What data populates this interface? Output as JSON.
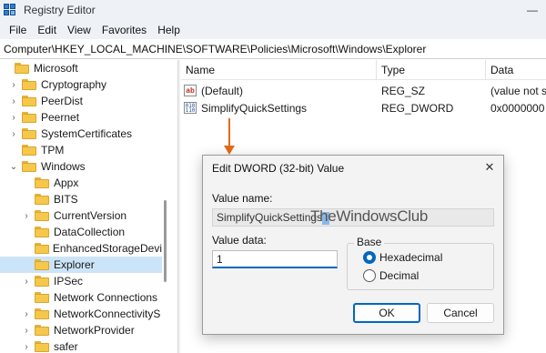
{
  "window": {
    "title": "Registry Editor",
    "minimize": "—",
    "close": "✕"
  },
  "menu": [
    "File",
    "Edit",
    "View",
    "Favorites",
    "Help"
  ],
  "address": "Computer\\HKEY_LOCAL_MACHINE\\SOFTWARE\\Policies\\Microsoft\\Windows\\Explorer",
  "tree": [
    {
      "label": "Microsoft",
      "chevron": "",
      "indent": 0
    },
    {
      "label": "Cryptography",
      "chevron": "›",
      "indent": 1
    },
    {
      "label": "PeerDist",
      "chevron": "›",
      "indent": 1
    },
    {
      "label": "Peernet",
      "chevron": "›",
      "indent": 1
    },
    {
      "label": "SystemCertificates",
      "chevron": "›",
      "indent": 1
    },
    {
      "label": "TPM",
      "chevron": "",
      "indent": 1
    },
    {
      "label": "Windows",
      "chevron": "⌄",
      "indent": 1
    },
    {
      "label": "Appx",
      "chevron": "",
      "indent": 2
    },
    {
      "label": "BITS",
      "chevron": "",
      "indent": 2
    },
    {
      "label": "CurrentVersion",
      "chevron": "›",
      "indent": 2
    },
    {
      "label": "DataCollection",
      "chevron": "",
      "indent": 2
    },
    {
      "label": "EnhancedStorageDevi",
      "chevron": "",
      "indent": 2
    },
    {
      "label": "Explorer",
      "chevron": "",
      "indent": 2,
      "selected": true
    },
    {
      "label": "IPSec",
      "chevron": "›",
      "indent": 2
    },
    {
      "label": "Network Connections",
      "chevron": "",
      "indent": 2
    },
    {
      "label": "NetworkConnectivityS",
      "chevron": "›",
      "indent": 2
    },
    {
      "label": "NetworkProvider",
      "chevron": "›",
      "indent": 2
    },
    {
      "label": "safer",
      "chevron": "›",
      "indent": 2
    }
  ],
  "list": {
    "columns": [
      "Name",
      "Type",
      "Data"
    ],
    "rows": [
      {
        "icon": "string-value-icon",
        "icon_text": "ab",
        "name": "(Default)",
        "type": "REG_SZ",
        "data": "(value not s"
      },
      {
        "icon": "dword-value-icon",
        "icon_text": "010\n110",
        "name": "SimplifyQuickSettings",
        "type": "REG_DWORD",
        "data": "0x0000000"
      }
    ]
  },
  "dialog": {
    "title": "Edit DWORD (32-bit) Value",
    "close": "✕",
    "value_name_label": "Value name:",
    "value_name": "SimplifyQuickSettings",
    "value_data_label": "Value data:",
    "value_data": "1",
    "base_label": "Base",
    "base_options": [
      "Hexadecimal",
      "Decimal"
    ],
    "base_selected": "Hexadecimal",
    "ok": "OK",
    "cancel": "Cancel"
  },
  "watermark": "TheWindowsClub",
  "colors": {
    "accent": "#0067c0",
    "arrow": "#e36a1a",
    "selection": "#cce4f7",
    "folder": "#f5c84c"
  }
}
